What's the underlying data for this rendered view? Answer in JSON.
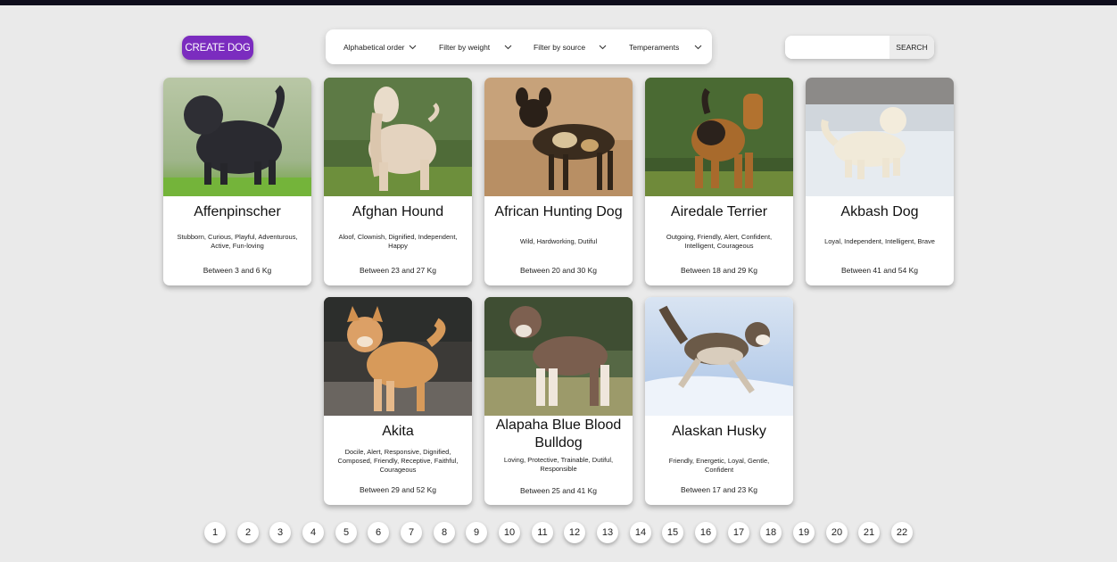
{
  "header": {
    "create_label": "CREATE DOG",
    "filters": [
      {
        "label": "Alphabetical order"
      },
      {
        "label": "Filter by weight"
      },
      {
        "label": "Filter by source"
      },
      {
        "label": "Temperaments"
      }
    ],
    "search": {
      "value": "",
      "placeholder": "",
      "button_label": "SEARCH"
    }
  },
  "colors": {
    "accent": "#7b2cbf",
    "background": "#eaeaea",
    "topbar": "#0f0d1c"
  },
  "cards": [
    {
      "name": "Affenpinscher",
      "temperaments": "Stubborn, Curious, Playful, Adventurous, Active, Fun-loving",
      "weight": "Between 3 and 6 Kg",
      "image": "dog-photo"
    },
    {
      "name": "Afghan Hound",
      "temperaments": "Aloof, Clownish, Dignified, Independent, Happy",
      "weight": "Between 23 and 27 Kg",
      "image": "dog-photo"
    },
    {
      "name": "African Hunting Dog",
      "temperaments": "Wild, Hardworking, Dutiful",
      "weight": "Between 20 and 30 Kg",
      "image": "dog-photo"
    },
    {
      "name": "Airedale Terrier",
      "temperaments": "Outgoing, Friendly, Alert, Confident, Intelligent, Courageous",
      "weight": "Between 18 and 29 Kg",
      "image": "dog-photo"
    },
    {
      "name": "Akbash Dog",
      "temperaments": "Loyal, Independent, Intelligent, Brave",
      "weight": "Between 41 and 54 Kg",
      "image": "dog-photo"
    },
    {
      "name": "Akita",
      "temperaments": "Docile, Alert, Responsive, Dignified, Composed, Friendly, Receptive, Faithful, Courageous",
      "weight": "Between 29 and 52 Kg",
      "image": "dog-photo"
    },
    {
      "name": "Alapaha Blue Blood Bulldog",
      "temperaments": "Loving, Protective, Trainable, Dutiful, Responsible",
      "weight": "Between 25 and 41 Kg",
      "image": "dog-photo"
    },
    {
      "name": "Alaskan Husky",
      "temperaments": "Friendly, Energetic, Loyal, Gentle, Confident",
      "weight": "Between 17 and 23 Kg",
      "image": "dog-photo"
    }
  ],
  "pagination": {
    "pages": [
      "1",
      "2",
      "3",
      "4",
      "5",
      "6",
      "7",
      "8",
      "9",
      "10",
      "11",
      "12",
      "13",
      "14",
      "15",
      "16",
      "17",
      "18",
      "19",
      "20",
      "21",
      "22"
    ]
  }
}
